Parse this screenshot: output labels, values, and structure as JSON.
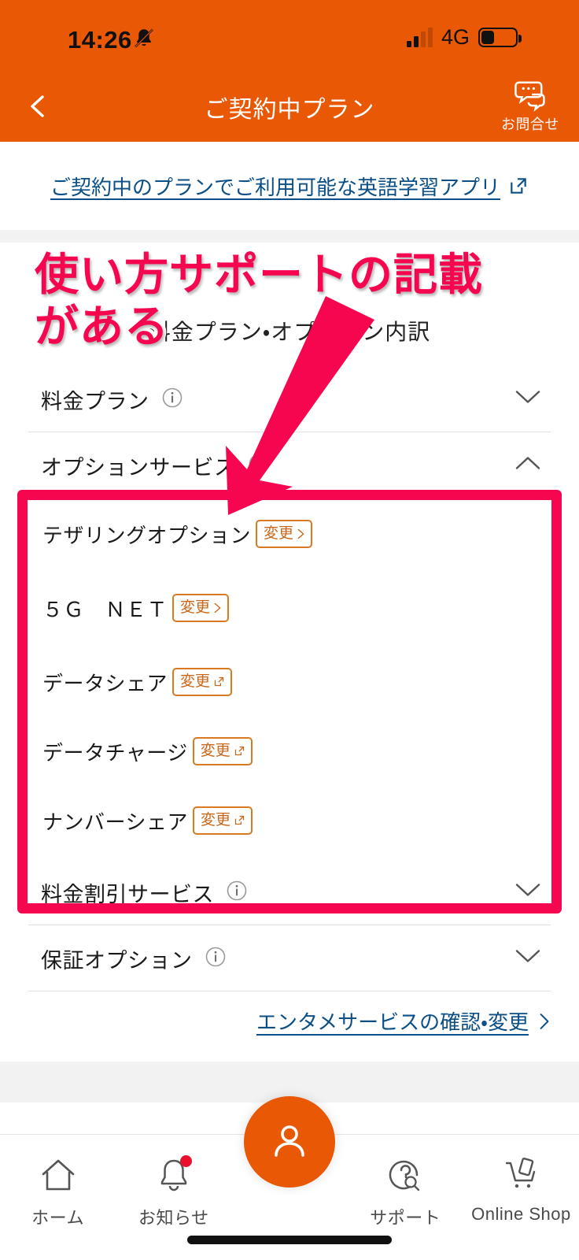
{
  "status_bar": {
    "time": "14:26",
    "bell_icon": "bell-muted-icon",
    "signal_icon": "signal-bars-icon",
    "signal_bars_filled": 2,
    "signal_bars_total": 4,
    "network": "4G",
    "battery_icon": "battery-low-icon"
  },
  "header": {
    "back_icon": "chevron-left-icon",
    "title": "ご契約中プラン",
    "contact_icon": "chat-bubble-icon",
    "contact_label": "お問合せ",
    "bg_color": "#e85805"
  },
  "top_link": {
    "text": "ご契約中のプランでご利用可能な英語学習アプリ",
    "external_icon": "external-link-icon",
    "color": "#0b4f86"
  },
  "main": {
    "section_title": "料金プラン・オプション内訳",
    "accordions": [
      {
        "label": "料金プラン",
        "info_icon": "info-circle-icon",
        "chevron": "chevron-down-icon",
        "expanded": false
      },
      {
        "label": "オプションサービス",
        "info_icon": "info-circle-icon",
        "chevron": "chevron-up-icon",
        "expanded": true
      },
      {
        "label": "料金割引サービス",
        "info_icon": "info-circle-icon",
        "chevron": "chevron-down-icon",
        "expanded": false
      },
      {
        "label": "保証オプション",
        "info_icon": "info-circle-icon",
        "chevron": "chevron-down-icon",
        "expanded": false
      }
    ],
    "option_services": [
      {
        "name": "テザリングオプション",
        "button_label": "変更",
        "button_icon": "chevron-right-icon"
      },
      {
        "name": "５Ｇ　ＮＥＴ",
        "button_label": "変更",
        "button_icon": "chevron-right-icon"
      },
      {
        "name": "データシェア",
        "button_label": "変更",
        "button_icon": "external-link-icon"
      },
      {
        "name": "データチャージ",
        "button_label": "変更",
        "button_icon": "external-link-icon"
      },
      {
        "name": "ナンバーシェア",
        "button_label": "変更",
        "button_icon": "external-link-icon"
      }
    ],
    "entame_link": {
      "text": "エンタメサービスの確認・変更",
      "chevron": "chevron-right-icon"
    },
    "button_border_color": "#d97a22",
    "button_text_color": "#c9661a"
  },
  "annotation": {
    "text": "使い方サポートの記載\nがある",
    "color": "#f5064f",
    "outline_color": "#ffffff",
    "box_color": "#f5064f",
    "arrow_icon": "arrow-pointer"
  },
  "tab_bar": {
    "items": [
      {
        "label": "ホーム",
        "icon": "home-icon",
        "badge": false
      },
      {
        "label": "お知らせ",
        "icon": "bell-icon",
        "badge": true
      },
      {
        "label": "",
        "icon": "person-icon",
        "badge": false
      },
      {
        "label": "サポート",
        "icon": "support-question-search-icon",
        "badge": false
      },
      {
        "label": "Online Shop",
        "icon": "cart-phone-icon",
        "badge": false
      }
    ],
    "fab": {
      "icon": "person-icon",
      "color": "#e85805"
    },
    "home_indicator": "home-indicator"
  }
}
